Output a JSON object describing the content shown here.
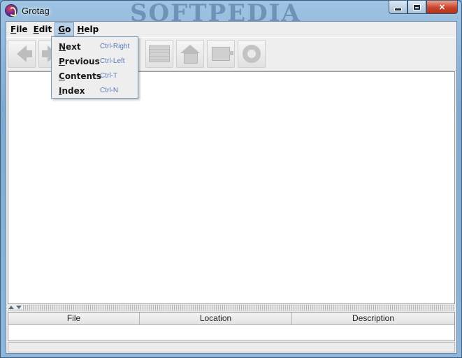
{
  "window": {
    "title": "Grotag",
    "watermark": "SOFTPEDIA"
  },
  "menubar": {
    "items": [
      {
        "mnemonic": "F",
        "rest": "ile"
      },
      {
        "mnemonic": "E",
        "rest": "dit"
      },
      {
        "mnemonic": "G",
        "rest": "o"
      },
      {
        "mnemonic": "H",
        "rest": "elp"
      }
    ],
    "open_menu": "Go"
  },
  "go_menu": {
    "items": [
      {
        "mnemonic": "N",
        "rest": "ext",
        "shortcut": "Ctrl-Right"
      },
      {
        "mnemonic": "P",
        "rest": "revious",
        "shortcut": "Ctrl-Left"
      },
      {
        "mnemonic": "C",
        "rest": "ontents",
        "shortcut": "Ctrl-T"
      },
      {
        "mnemonic": "I",
        "rest": "ndex",
        "shortcut": "Ctrl-N"
      }
    ]
  },
  "toolbar": {
    "buttons": [
      "back-icon",
      "forward-icon",
      "contents-icon",
      "home-icon",
      "index-icon",
      "help-icon"
    ],
    "enabled": false
  },
  "table": {
    "columns": [
      "File",
      "Location",
      "Description"
    ]
  },
  "colors": {
    "menu_open_bg": "#b8cfe5",
    "accelerator_text": "#5c79b8",
    "close_button": "#c9442b"
  }
}
